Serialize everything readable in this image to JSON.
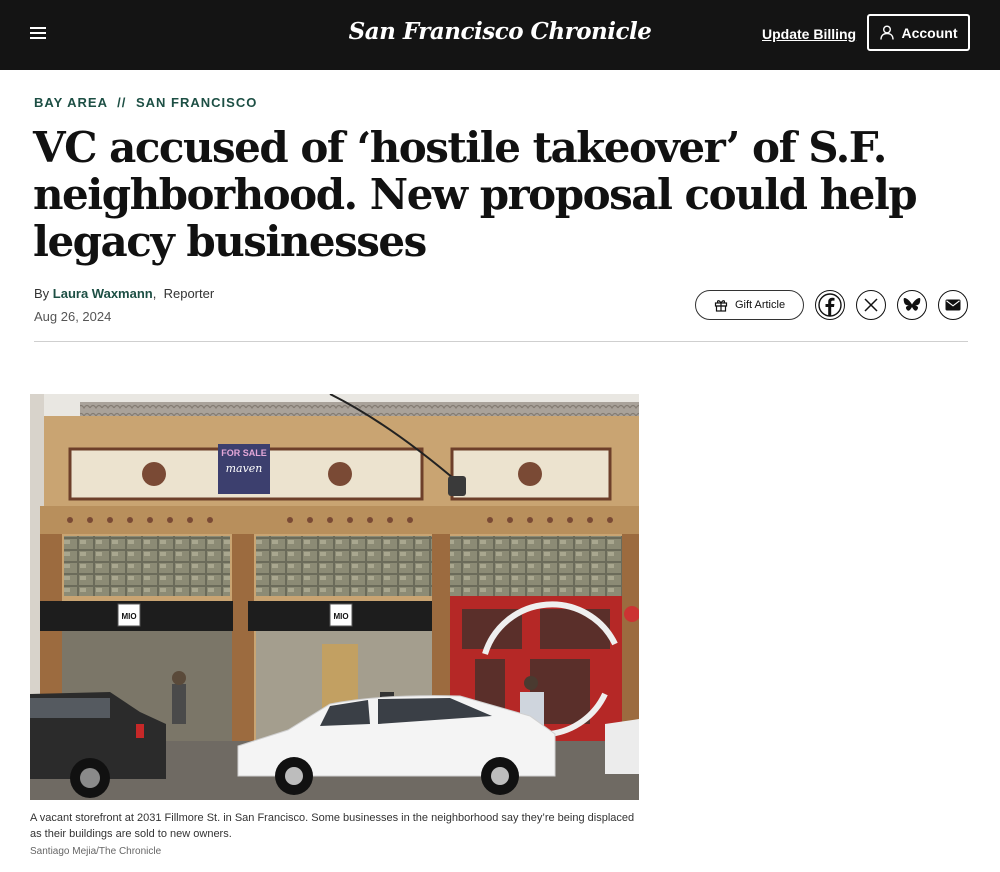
{
  "header": {
    "logo": "San Francisco Chronicle",
    "menu_icon": "hamburger-menu-icon",
    "update_billing": "Update Billing",
    "account": "Account",
    "account_icon": "user-icon"
  },
  "article": {
    "kicker": [
      "BAY AREA",
      "SAN FRANCISCO"
    ],
    "kicker_separator": "//",
    "headline": "VC accused of ‘hostile takeover’ of S.F. neighborhood. New proposal could help legacy businesses",
    "byline_prefix": "By",
    "author": "Laura Waxmann",
    "role": "Reporter",
    "date": "Aug 26, 2024"
  },
  "share": {
    "gift_label": "Gift Article",
    "gift_icon": "gift-icon",
    "buttons": [
      "facebook-icon",
      "x-icon",
      "bluesky-icon",
      "email-icon"
    ]
  },
  "photo": {
    "sign_top": "FOR SALE",
    "sign_brand": "maven",
    "store_sign": "MIO",
    "caption": "A vacant storefront at 2031 Fillmore St. in San Francisco. Some businesses in the neighborhood say they’re being displaced as their buildings are sold to new owners.",
    "credit": "Santiago Mejia/The Chronicle"
  },
  "colors": {
    "topbar": "#141414",
    "accent": "#1d4f44",
    "facade": "#c9a472",
    "red_door": "#b52826"
  }
}
